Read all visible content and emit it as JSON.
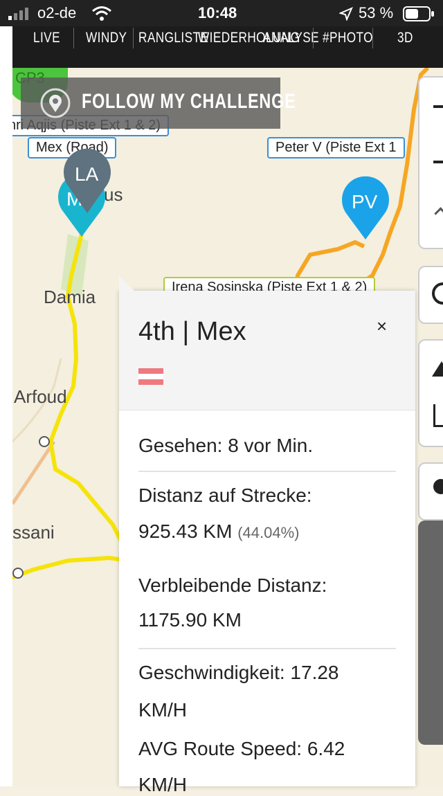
{
  "status": {
    "carrier": "o2-de",
    "time": "10:48",
    "battery": "53 %"
  },
  "nav": {
    "items": [
      "LIVE",
      "WINDY",
      "RANGLISTE",
      "WIEDERHOLUNG",
      "ANALYSE",
      "#PHOTO",
      "3D"
    ]
  },
  "banner": {
    "text": "FOLLOW MY CHALLENGE"
  },
  "map": {
    "labels": {
      "cp": "CP3",
      "henri": "nri Aqjis (Piste Ext 1 & 2)",
      "mex": "Mex (Road)",
      "peter": "Peter V (Piste Ext 1",
      "irena": "Irena Sosinska (Piste Ext 1 & 2)"
    },
    "places": {
      "damia": "Damia",
      "arfoud": "Arfoud",
      "ssani": "ssani",
      "marcus": "us"
    },
    "markers": {
      "la": "LA",
      "pv": "PV",
      "m": "M"
    }
  },
  "popup": {
    "title": "4th | Mex",
    "close": "×",
    "seen": "Gesehen: 8 vor Min.",
    "dist_label": "Distanz auf Strecke:",
    "dist_value": "925.43 KM",
    "dist_pct": "(44.04%)",
    "remaining_label": "Verbleibende Distanz:",
    "remaining_value": "1175.90 KM",
    "speed_label": "Geschwindigkeit: 17.28",
    "speed_unit": "KM/H",
    "avg_label": "AVG Route Speed: 6.42",
    "avg_unit": "KM/H"
  },
  "colors": {
    "route": "#f5e30a",
    "orange_route": "#f6a623",
    "marker_blue": "#1aa3e8",
    "marker_teal": "#19b5cf",
    "marker_grey": "#5e7280",
    "flag_red": "#ee7a7f"
  }
}
